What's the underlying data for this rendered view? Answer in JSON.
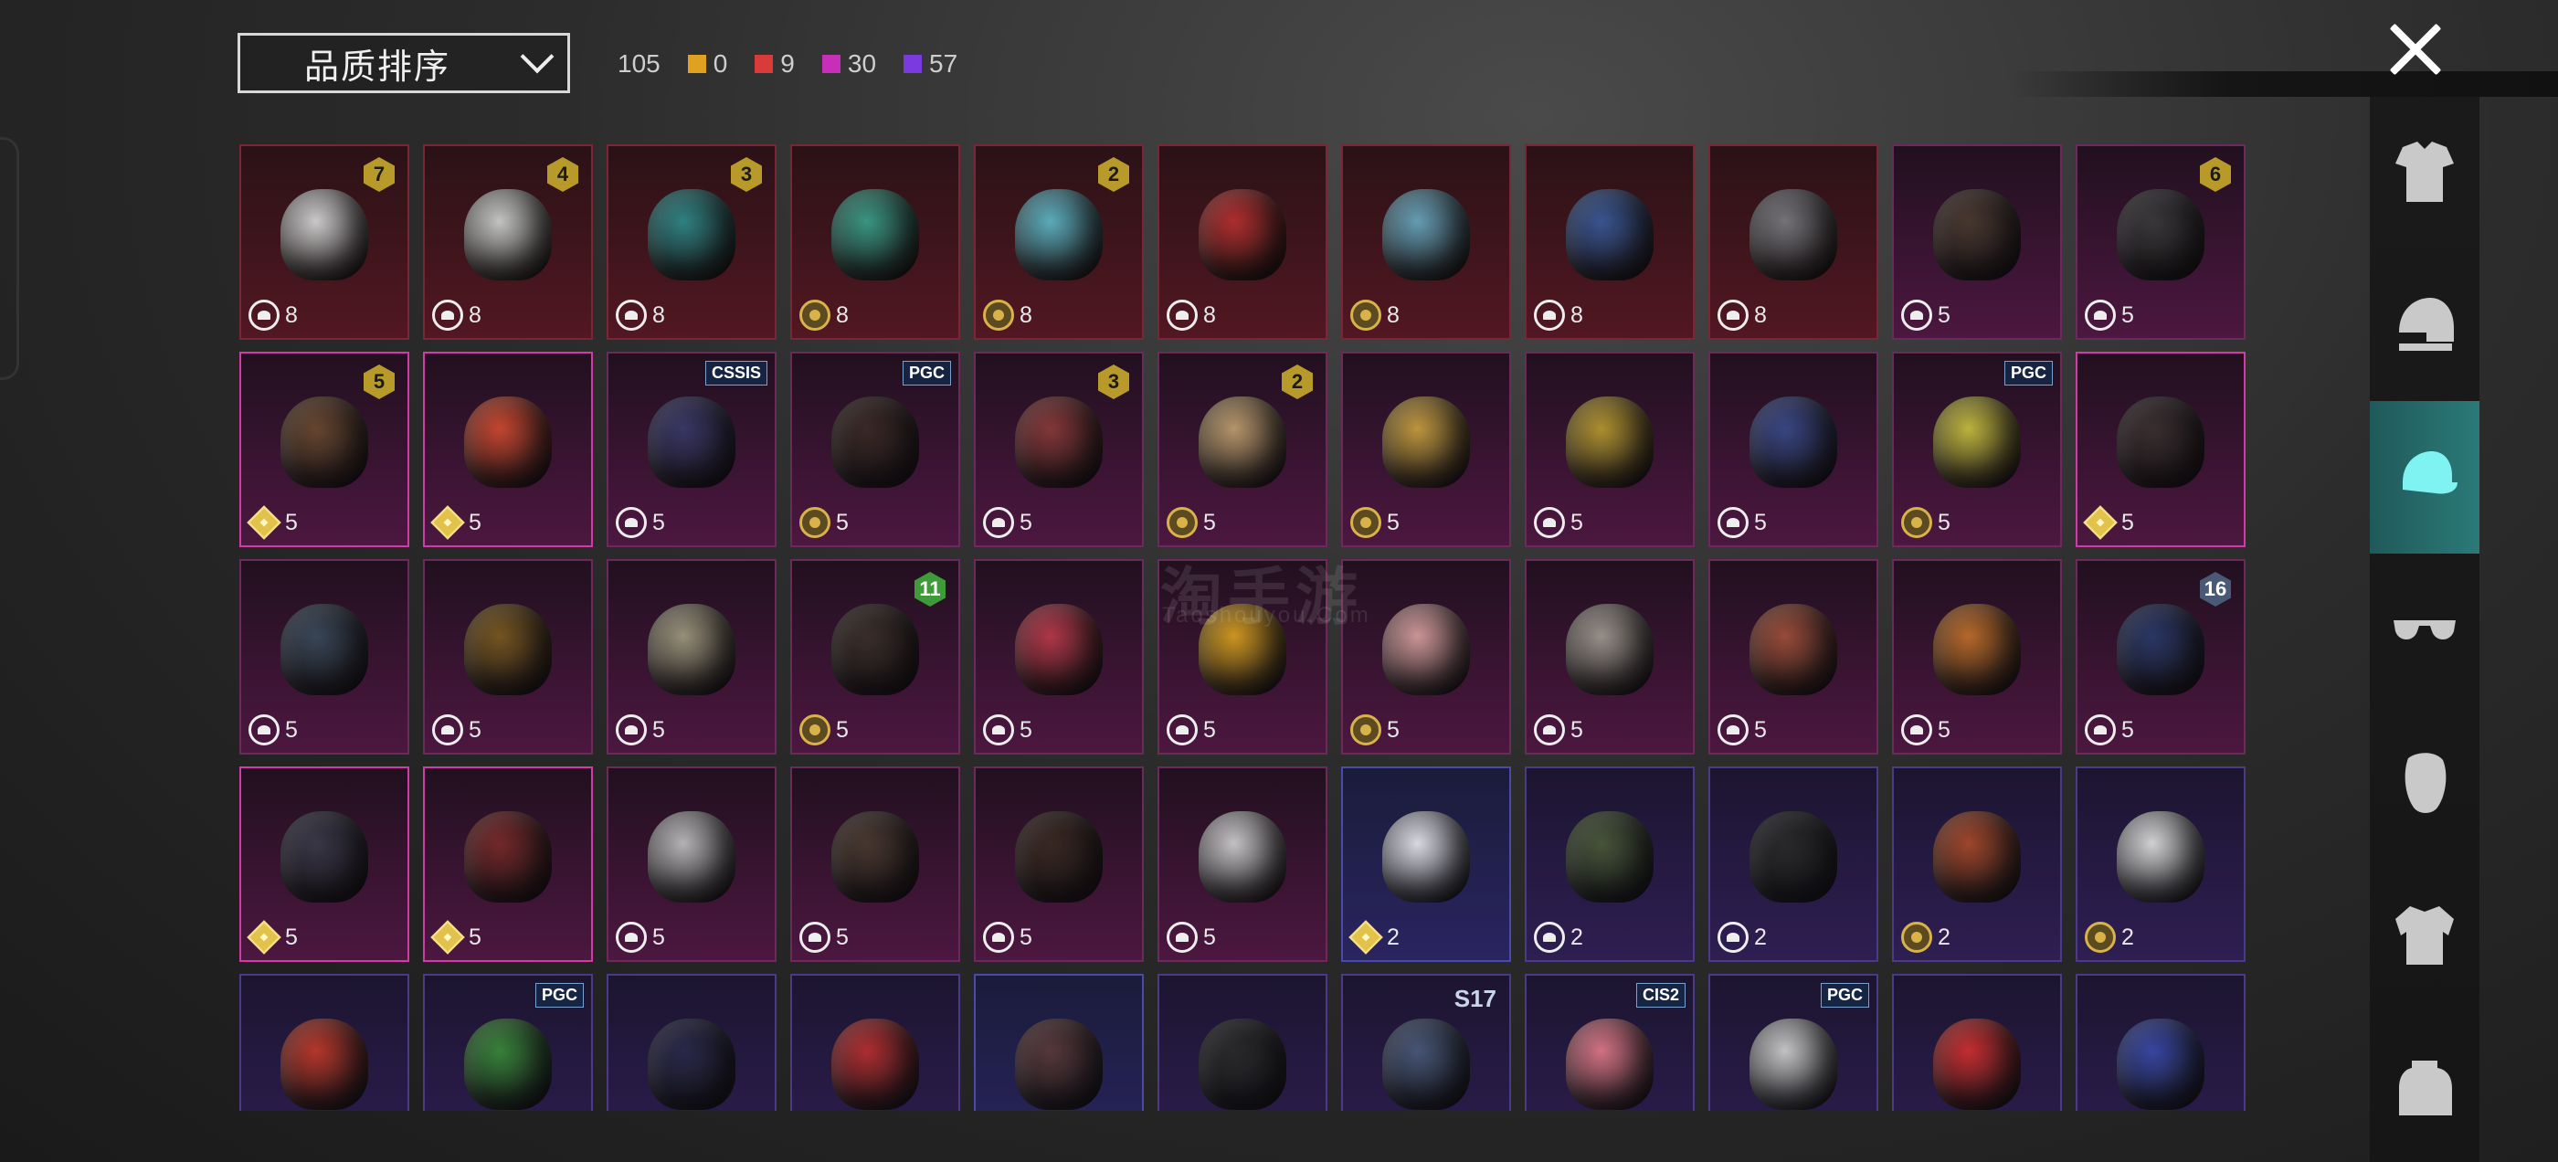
{
  "sort": {
    "label": "品质排序"
  },
  "counts": {
    "total": "105",
    "items": [
      {
        "color": "#e0a020",
        "value": "0"
      },
      {
        "color": "#d93a3a",
        "value": "9"
      },
      {
        "color": "#c82fb8",
        "value": "30"
      },
      {
        "color": "#7a3ae0",
        "value": "57"
      }
    ]
  },
  "watermark": {
    "main": "淘手游",
    "sub": "Taoshouyou.Com"
  },
  "sidebar": [
    "outfit-icon",
    "helmet-icon",
    "hat-icon",
    "glasses-icon",
    "mask-icon",
    "jacket-icon",
    "backpack-icon"
  ],
  "tiles": [
    {
      "tier": "red",
      "icon": "cloud",
      "qty": "8",
      "badge": "7",
      "color": "#d8d8d8"
    },
    {
      "tier": "red",
      "icon": "cloud",
      "qty": "8",
      "badge": "4",
      "color": "#cfd3d0"
    },
    {
      "tier": "red",
      "icon": "cloud",
      "qty": "8",
      "badge": "3",
      "color": "#2f8a8a"
    },
    {
      "tier": "red",
      "icon": "coin",
      "qty": "8",
      "color": "#3aa08a"
    },
    {
      "tier": "red",
      "icon": "coin",
      "qty": "8",
      "badge": "2",
      "color": "#5fb8c8"
    },
    {
      "tier": "red",
      "icon": "cloud",
      "qty": "8",
      "color": "#b83030"
    },
    {
      "tier": "red",
      "icon": "coin",
      "qty": "8",
      "color": "#6aa8c0"
    },
    {
      "tier": "red",
      "icon": "cloud",
      "qty": "8",
      "color": "#3a5a9a"
    },
    {
      "tier": "red",
      "icon": "cloud",
      "qty": "8",
      "color": "#7a7a80"
    },
    {
      "tier": "pink",
      "icon": "cloud",
      "qty": "5",
      "color": "#4a3a30"
    },
    {
      "tier": "pink",
      "icon": "cloud",
      "qty": "5",
      "badge": "6",
      "color": "#3a3a3a"
    },
    {
      "tier": "pink",
      "sel": true,
      "icon": "diamond",
      "qty": "5",
      "badge": "5",
      "color": "#6a4a30"
    },
    {
      "tier": "pink",
      "sel": true,
      "icon": "diamond",
      "qty": "5",
      "color": "#d04a30"
    },
    {
      "tier": "pink",
      "icon": "cloud",
      "qty": "5",
      "text": "CSSIS",
      "color": "#3a3a6a"
    },
    {
      "tier": "pink",
      "icon": "coin",
      "qty": "5",
      "text": "PGC",
      "color": "#3a2a26"
    },
    {
      "tier": "pink",
      "icon": "cloud",
      "qty": "5",
      "badge": "3",
      "color": "#8a3a3a"
    },
    {
      "tier": "pink",
      "icon": "coin",
      "qty": "5",
      "badge": "2",
      "color": "#c0a070"
    },
    {
      "tier": "pink",
      "icon": "coin",
      "qty": "5",
      "color": "#c8a040"
    },
    {
      "tier": "pink",
      "icon": "cloud",
      "qty": "5",
      "color": "#b89a30"
    },
    {
      "tier": "pink",
      "icon": "cloud",
      "qty": "5",
      "color": "#3a4a8a"
    },
    {
      "tier": "pink",
      "icon": "coin",
      "qty": "5",
      "text": "PGC",
      "color": "#c8c040"
    },
    {
      "tier": "pink",
      "sel": true,
      "icon": "diamond",
      "qty": "5",
      "color": "#3a3030"
    },
    {
      "tier": "pink",
      "icon": "cloud",
      "qty": "5",
      "color": "#3a4a5a"
    },
    {
      "tier": "pink",
      "icon": "cloud",
      "qty": "5",
      "color": "#7a5a20"
    },
    {
      "tier": "pink",
      "icon": "cloud",
      "qty": "5",
      "color": "#a09a80"
    },
    {
      "tier": "pink",
      "icon": "coin",
      "qty": "5",
      "badge": "11",
      "badgeStyle": "green",
      "color": "#3a302a"
    },
    {
      "tier": "pink",
      "icon": "cloud",
      "qty": "5",
      "color": "#b83a4a"
    },
    {
      "tier": "pink",
      "icon": "cloud",
      "qty": "5",
      "color": "#d8a020"
    },
    {
      "tier": "pink",
      "icon": "coin",
      "qty": "5",
      "color": "#d8a0a0"
    },
    {
      "tier": "pink",
      "icon": "cloud",
      "qty": "5",
      "color": "#a09a90"
    },
    {
      "tier": "pink",
      "icon": "cloud",
      "qty": "5",
      "color": "#a0503a"
    },
    {
      "tier": "pink",
      "icon": "cloud",
      "qty": "5",
      "color": "#c0702a"
    },
    {
      "tier": "pink",
      "icon": "cloud",
      "qty": "5",
      "badge": "16",
      "badgeStyle": "slate",
      "color": "#2a3a6a"
    },
    {
      "tier": "pink",
      "sel": true,
      "icon": "diamond",
      "qty": "5",
      "color": "#3a3a4a"
    },
    {
      "tier": "pink",
      "sel": true,
      "icon": "diamond",
      "qty": "5",
      "color": "#7a2a2a"
    },
    {
      "tier": "pink",
      "icon": "cloud",
      "qty": "5",
      "color": "#c0c0c0"
    },
    {
      "tier": "pink",
      "icon": "cloud",
      "qty": "5",
      "color": "#4a3a30"
    },
    {
      "tier": "pink",
      "icon": "cloud",
      "qty": "5",
      "color": "#3a2a22"
    },
    {
      "tier": "pink",
      "icon": "cloud",
      "qty": "5",
      "color": "#d0d0d0"
    },
    {
      "tier": "blue",
      "icon": "diamond",
      "qty": "2",
      "color": "#e8e8f0"
    },
    {
      "tier": "purple",
      "icon": "cloud",
      "qty": "2",
      "color": "#4a5a3a"
    },
    {
      "tier": "purple",
      "icon": "cloud",
      "qty": "2",
      "color": "#2a2a2a"
    },
    {
      "tier": "purple",
      "icon": "coin",
      "qty": "2",
      "color": "#a84a2a"
    },
    {
      "tier": "purple",
      "icon": "coin",
      "qty": "2",
      "color": "#e0e0e0"
    },
    {
      "tier": "purple",
      "color": "#c03a2a"
    },
    {
      "tier": "purple",
      "text": "PGC",
      "color": "#3a8a3a"
    },
    {
      "tier": "purple",
      "color": "#2a2a4a"
    },
    {
      "tier": "purple",
      "color": "#b83030"
    },
    {
      "tier": "blue",
      "color": "#5a3a3a"
    },
    {
      "tier": "purple",
      "color": "#2a2a2a"
    },
    {
      "tier": "purple",
      "text": "S17",
      "textStyle": "plain",
      "color": "#4a5a7a"
    },
    {
      "tier": "purple",
      "text": "CIS2",
      "color": "#e07a8a"
    },
    {
      "tier": "purple",
      "text": "PGC",
      "color": "#d0d0d0"
    },
    {
      "tier": "purple",
      "color": "#d03030"
    },
    {
      "tier": "purple",
      "color": "#3a4aa8"
    }
  ]
}
